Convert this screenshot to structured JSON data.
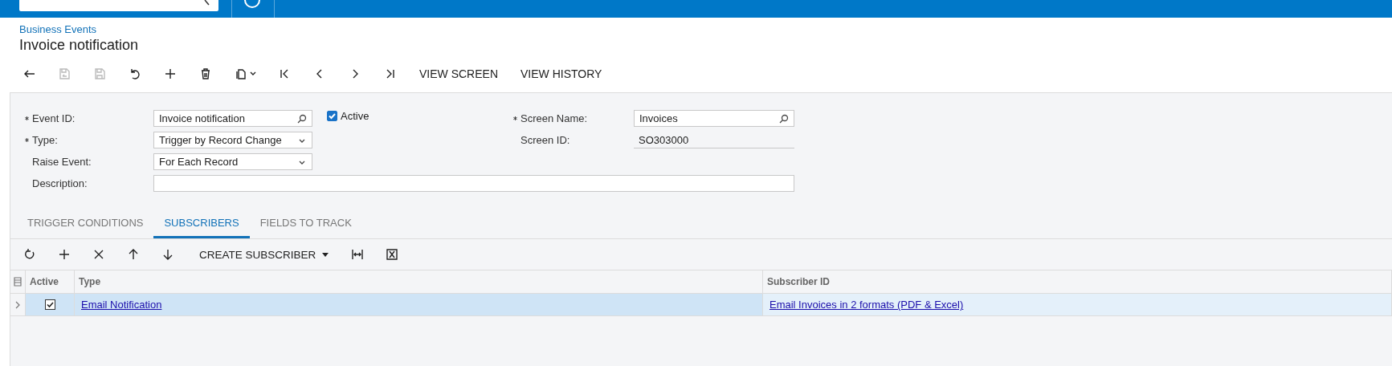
{
  "breadcrumb": "Business Events",
  "title": "Invoice notification",
  "toolbar": {
    "icons": [
      {
        "kind": "back",
        "disabled": false
      },
      {
        "kind": "save-close",
        "disabled": true
      },
      {
        "kind": "save",
        "disabled": true
      },
      {
        "kind": "undo",
        "disabled": false
      },
      {
        "kind": "add",
        "disabled": false
      },
      {
        "kind": "delete",
        "disabled": false
      },
      {
        "kind": "copy",
        "disabled": false
      },
      {
        "kind": "first",
        "disabled": false
      },
      {
        "kind": "prev",
        "disabled": false
      },
      {
        "kind": "next",
        "disabled": false
      },
      {
        "kind": "last",
        "disabled": false
      }
    ],
    "buttons": [
      "VIEW SCREEN",
      "VIEW HISTORY"
    ]
  },
  "form": {
    "left": [
      {
        "label": "Event ID:",
        "required": true,
        "value": "Invoice notification",
        "kind": "lookup"
      },
      {
        "label": "Type:",
        "required": true,
        "value": "Trigger by Record Change",
        "kind": "select"
      },
      {
        "label": "Raise Event:",
        "required": false,
        "value": "For Each Record",
        "kind": "select"
      }
    ],
    "active": {
      "label": "Active",
      "checked": true
    },
    "right": [
      {
        "label": "Screen Name:",
        "required": true,
        "value": "Invoices",
        "kind": "lookup"
      },
      {
        "label": "Screen ID:",
        "required": false,
        "value": "SO303000",
        "kind": "readonly"
      }
    ],
    "description": {
      "label": "Description:",
      "required": false
    }
  },
  "tabs": [
    {
      "label": "TRIGGER CONDITIONS",
      "selected": false
    },
    {
      "label": "SUBSCRIBERS",
      "selected": true
    },
    {
      "label": "FIELDS TO TRACK",
      "selected": false
    }
  ],
  "grid_toolbar": {
    "icons": [
      {
        "kind": "refresh"
      },
      {
        "kind": "add"
      },
      {
        "kind": "remove"
      },
      {
        "kind": "up"
      },
      {
        "kind": "down"
      }
    ],
    "create": "CREATE SUBSCRIBER",
    "tail_icons": [
      {
        "kind": "fit"
      },
      {
        "kind": "excel"
      }
    ]
  },
  "grid": {
    "columns": [
      "Active",
      "Type",
      "Subscriber ID"
    ],
    "rows": [
      {
        "selected": true,
        "active": true,
        "type": "Email Notification",
        "subscriber_id": "Email Invoices in 2 formats (PDF & Excel)"
      }
    ]
  }
}
